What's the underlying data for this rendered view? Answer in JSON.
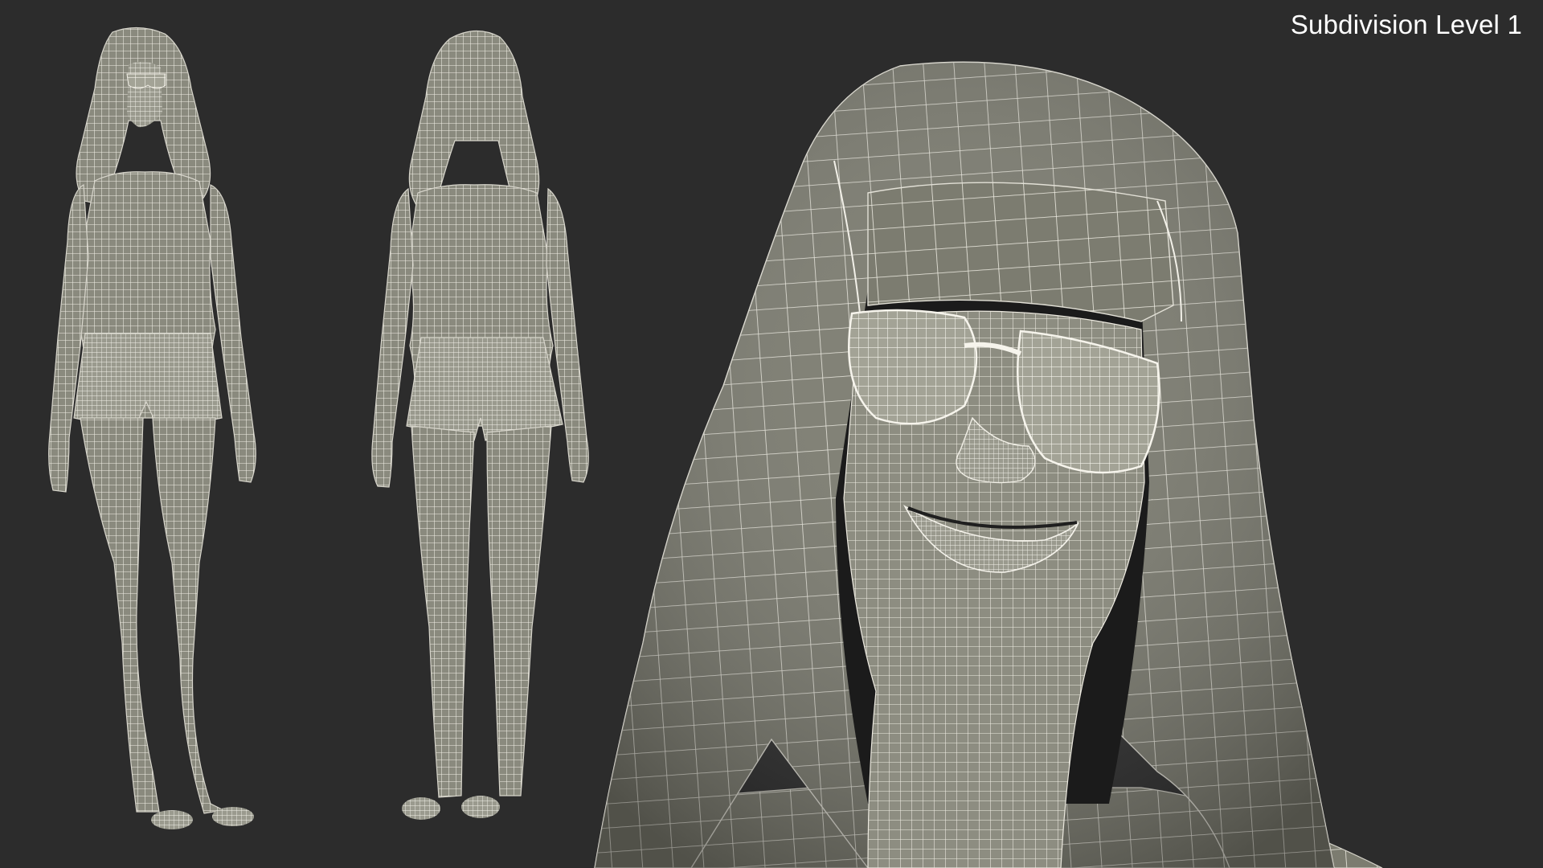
{
  "render": {
    "label": "Subdivision Level 1",
    "background_color": "#2c2c2c",
    "mesh_fill_color": "#8e8e82",
    "wire_color": "#f1efe6",
    "figures": [
      {
        "name": "front-view-figure"
      },
      {
        "name": "back-view-figure"
      },
      {
        "name": "head-closeup"
      }
    ]
  }
}
